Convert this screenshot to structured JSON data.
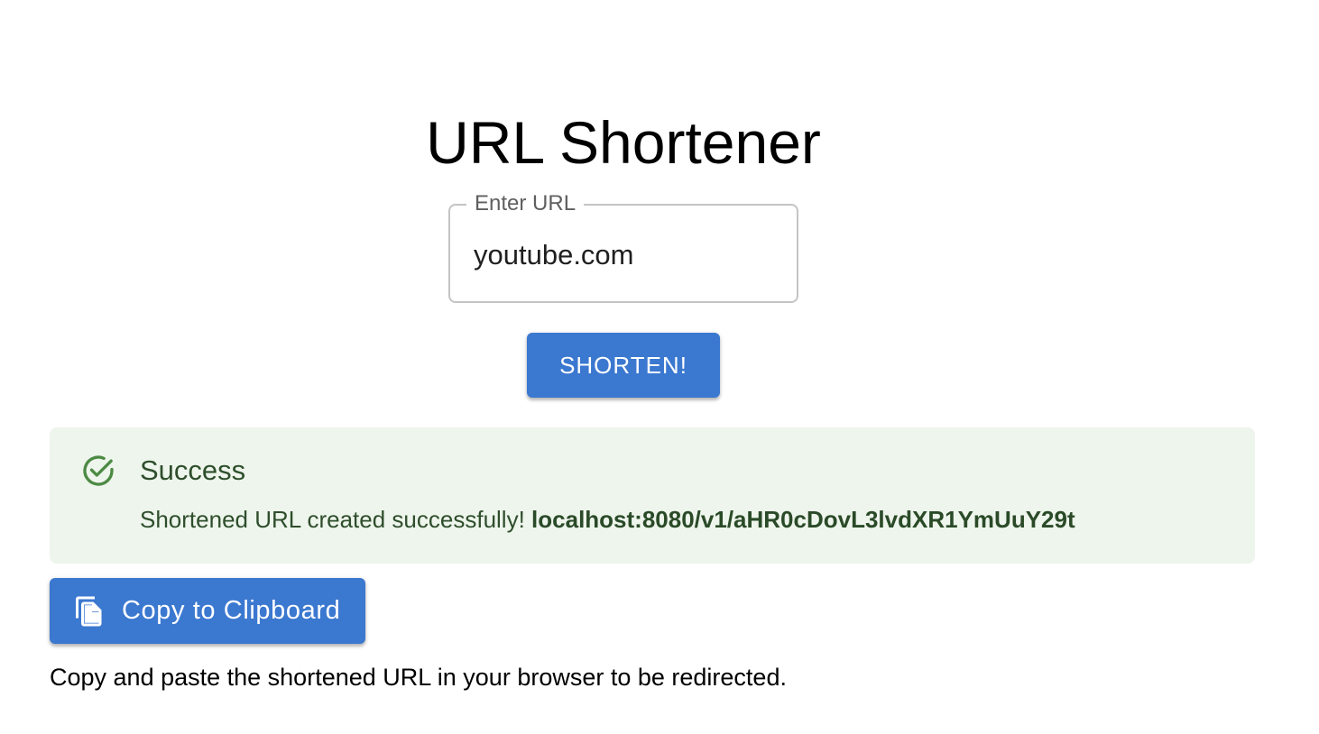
{
  "header": {
    "title": "URL Shortener"
  },
  "form": {
    "url_label": "Enter URL",
    "url_value": "youtube.com",
    "submit_label": "SHORTEN!"
  },
  "alert": {
    "icon": "check-circle-icon",
    "title": "Success",
    "message": "Shortened URL created successfully!",
    "short_url": "localhost:8080/v1/aHR0cDovL3lvdXR1YmUuY29t"
  },
  "copy": {
    "icon": "copy-icon",
    "label": "Copy to Clipboard"
  },
  "hint": "Copy and paste the shortened URL in your browser to be redirected.",
  "colors": {
    "primary": "#3b78d0",
    "success_bg": "#eef5ec",
    "success_text": "#2e4e2c",
    "success_icon": "#4c8a44"
  }
}
